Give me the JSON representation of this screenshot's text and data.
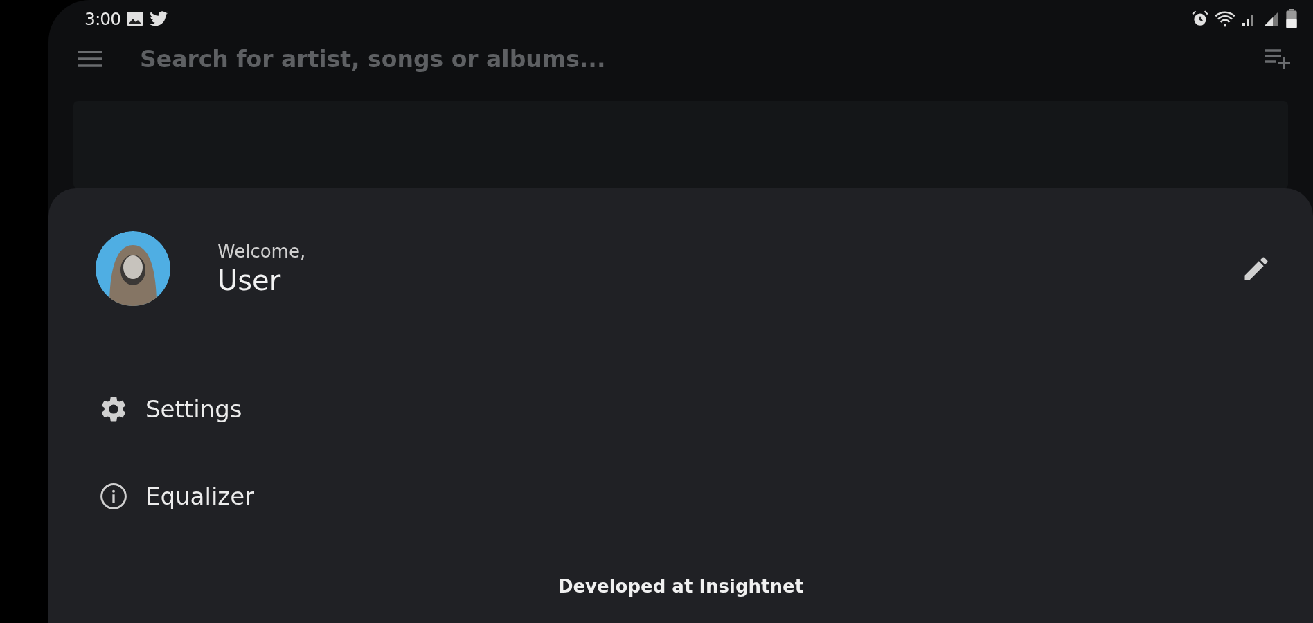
{
  "status_bar": {
    "time": "3:00"
  },
  "search": {
    "placeholder": "Search for artist, songs or albums..."
  },
  "drawer": {
    "greeting": "Welcome,",
    "user_name": "User",
    "menu": [
      {
        "kind": "settings",
        "label": "Settings"
      },
      {
        "kind": "info",
        "label": "Equalizer"
      }
    ],
    "footer": "Developed at Insightnet"
  }
}
